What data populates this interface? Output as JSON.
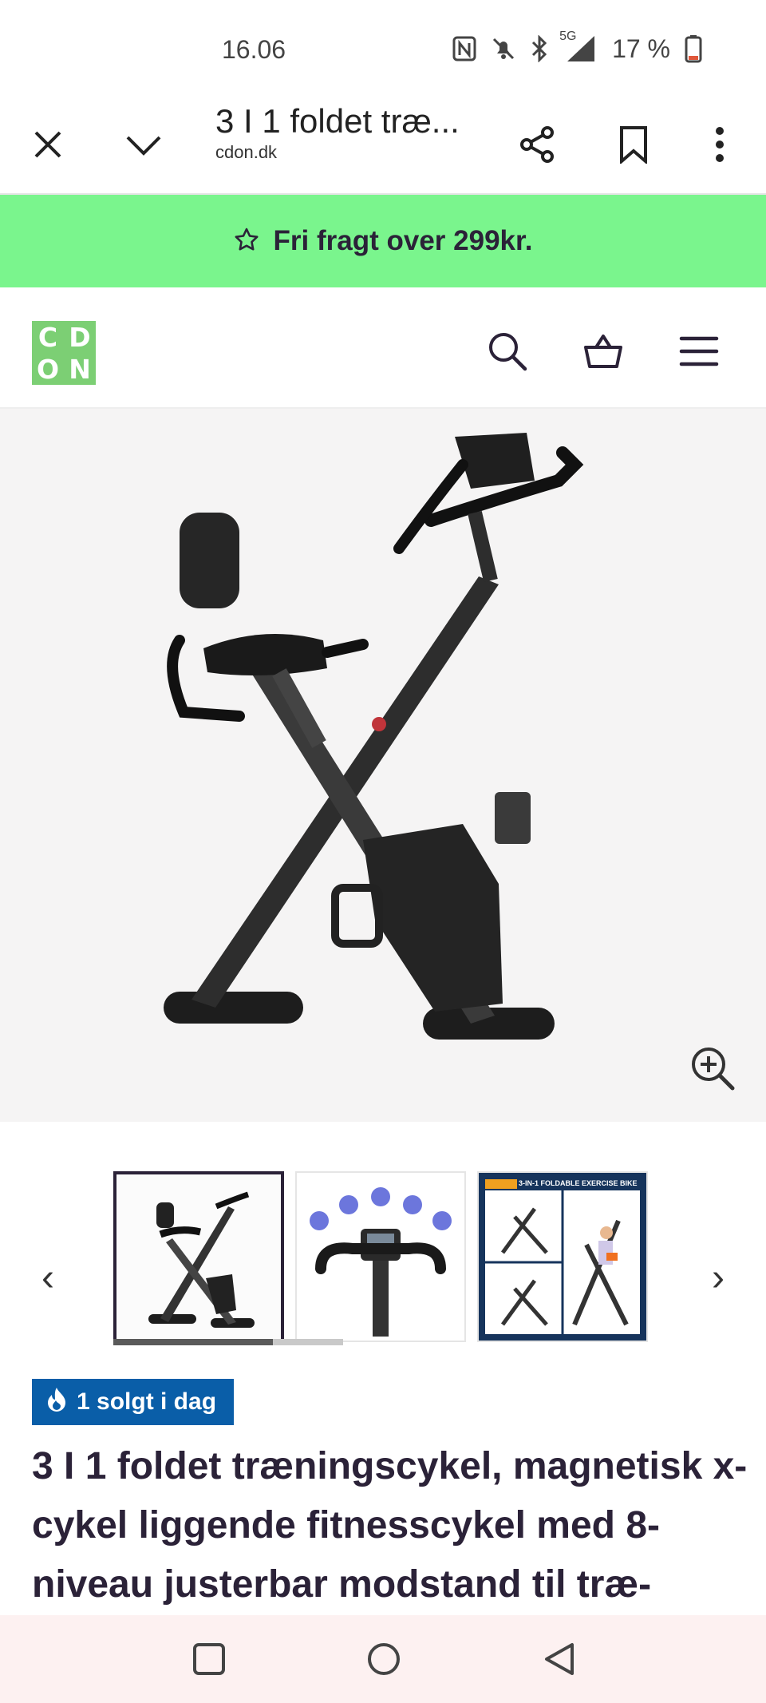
{
  "status_bar": {
    "time": "16.06",
    "network": "5G",
    "battery": "17 %"
  },
  "browser": {
    "title": "3 I 1 foldet træ...",
    "url": "cdon.dk",
    "icons": [
      "close-icon",
      "chevron-down-icon",
      "share-icon",
      "bookmark-icon",
      "more-vertical-icon"
    ]
  },
  "promo": {
    "text": "Fri fragt over 299kr.",
    "icon": "star-outline-icon",
    "color": "#7af58d"
  },
  "header": {
    "logo_letters": [
      "C",
      "D",
      "O",
      "N"
    ],
    "logo_color": "#7ccf74",
    "icons": [
      "search-icon",
      "basket-icon",
      "menu-icon"
    ]
  },
  "product": {
    "zoom_icon": "zoom-in-icon",
    "thumbnails": [
      {
        "name": "thumbnail-bike",
        "active": true
      },
      {
        "name": "thumbnail-console",
        "active": false
      },
      {
        "name": "thumbnail-3in1",
        "caption": "3-IN-1 FOLDABLE EXERCISE BIKE",
        "active": false
      }
    ],
    "prev_arrow": "‹",
    "next_arrow": "›",
    "badge": "1 solgt i dag",
    "badge_color": "#0a5ea8",
    "title": "3 I 1 foldet træningscykel, magnetisk x-cykel liggende fitnesscykel med 8-niveau justerbar modstand til træ-"
  },
  "nav_bar": {
    "icons": [
      "recents-square-icon",
      "home-circle-icon",
      "back-triangle-icon"
    ]
  }
}
